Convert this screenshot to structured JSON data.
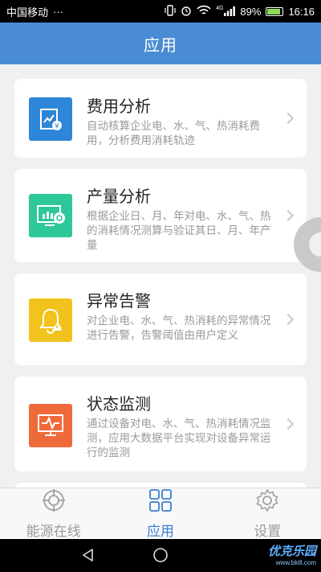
{
  "status_bar": {
    "carrier": "中国移动",
    "more": "···",
    "signal_label": "4G",
    "battery_percent": "89%",
    "battery_level": 0.89,
    "time": "16:16",
    "icons": [
      "vibrate-icon",
      "alarm-icon",
      "wifi-icon",
      "signal-icon",
      "battery-icon"
    ]
  },
  "header": {
    "title": "应用"
  },
  "cards": [
    {
      "title": "费用分析",
      "desc": "自动核算企业电、水、气、热消耗费用，分析费用消耗轨迹",
      "icon": "cost-chart-icon",
      "color": "#2e86d8"
    },
    {
      "title": "产量分析",
      "desc": "根据企业日、月、年对电、水、气、热的消耗情况测算与验证其日、月、年产量",
      "icon": "production-monitor-icon",
      "color": "#2ec79a"
    },
    {
      "title": "异常告警",
      "desc": "对企业电、水、气、热消耗的异常情况进行告警，告警阈值由用户定义",
      "icon": "alarm-bell-icon",
      "color": "#f1c31c"
    },
    {
      "title": "状态监测",
      "desc": "通过设备对电、水、气、热消耗情况监测，应用大数据平台实现对设备异常运行的监测",
      "icon": "status-monitor-icon",
      "color": "#ef6a3a"
    }
  ],
  "tabs": [
    {
      "label": "能源在线",
      "icon": "energy-target-icon"
    },
    {
      "label": "应用",
      "icon": "grid-apps-icon"
    },
    {
      "label": "设置",
      "icon": "settings-gear-icon"
    }
  ],
  "nav": {
    "back": "back-icon",
    "home": "home-icon"
  },
  "watermark": {
    "brand": "优克乐园",
    "url": "www.bkill.com"
  }
}
